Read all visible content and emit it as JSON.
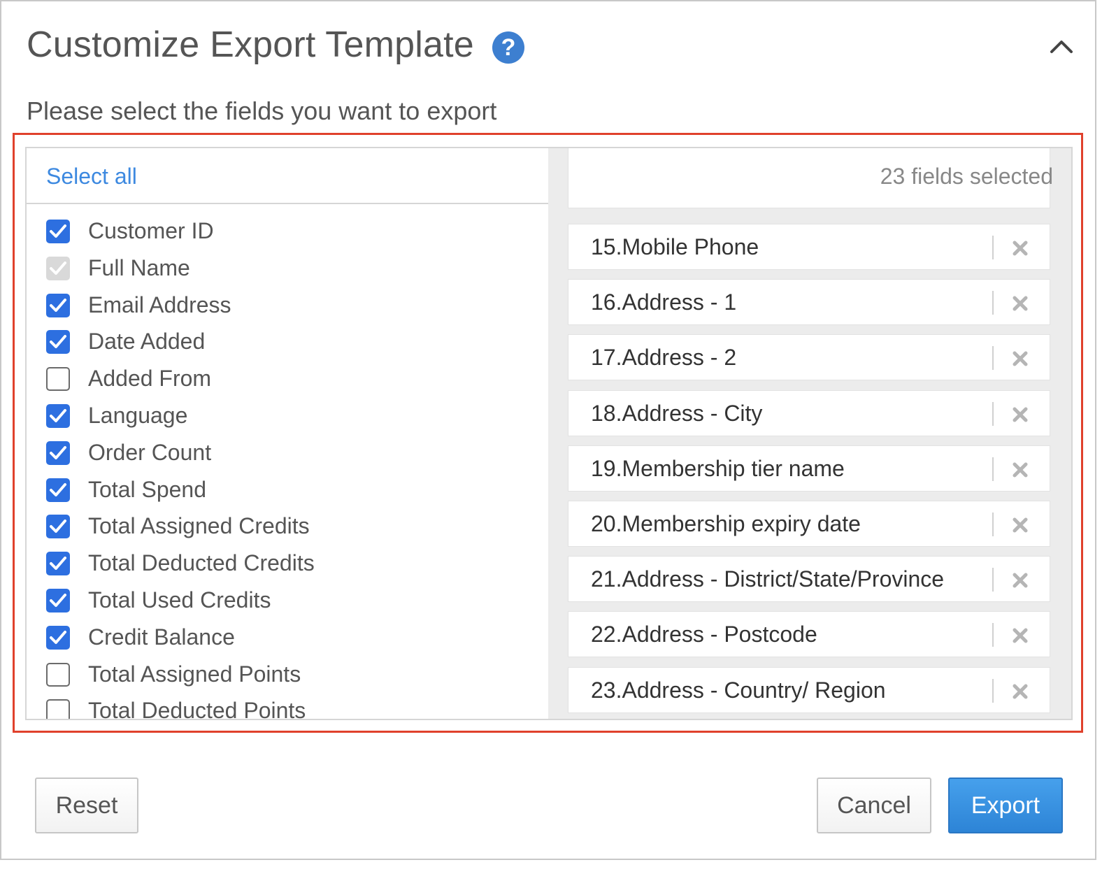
{
  "dialog": {
    "title": "Customize Export Template",
    "help_icon": "question-circle-icon",
    "collapse_icon": "chevron-up-icon",
    "subtitle": "Please select the fields you want to export"
  },
  "left_panel": {
    "select_all_label": "Select all",
    "fields": [
      {
        "label": "Customer ID",
        "state": "checked"
      },
      {
        "label": "Full Name",
        "state": "disabled-checked"
      },
      {
        "label": "Email Address",
        "state": "checked"
      },
      {
        "label": "Date Added",
        "state": "checked"
      },
      {
        "label": "Added From",
        "state": "unchecked"
      },
      {
        "label": "Language",
        "state": "checked"
      },
      {
        "label": "Order Count",
        "state": "checked"
      },
      {
        "label": "Total Spend",
        "state": "checked"
      },
      {
        "label": "Total Assigned Credits",
        "state": "checked"
      },
      {
        "label": "Total Deducted Credits",
        "state": "checked"
      },
      {
        "label": "Total Used Credits",
        "state": "checked"
      },
      {
        "label": "Credit Balance",
        "state": "checked"
      },
      {
        "label": "Total Assigned Points",
        "state": "unchecked"
      },
      {
        "label": "Total Deducted Points",
        "state": "unchecked"
      }
    ]
  },
  "right_panel": {
    "count_label": "23 fields selected",
    "remove_icon": "close-icon",
    "selected_fields": [
      {
        "label": "15.Mobile Phone"
      },
      {
        "label": "16.Address - 1"
      },
      {
        "label": "17.Address - 2"
      },
      {
        "label": "18.Address - City"
      },
      {
        "label": "19.Membership tier name"
      },
      {
        "label": "20.Membership expiry date"
      },
      {
        "label": "21.Address - District/State/Province"
      },
      {
        "label": "22.Address - Postcode"
      },
      {
        "label": "23.Address - Country/ Region"
      }
    ]
  },
  "footer": {
    "reset_label": "Reset",
    "cancel_label": "Cancel",
    "export_label": "Export"
  },
  "colors": {
    "accent": "#2d6fe0",
    "highlight_border": "#e0412c",
    "link": "#3d89e0"
  }
}
